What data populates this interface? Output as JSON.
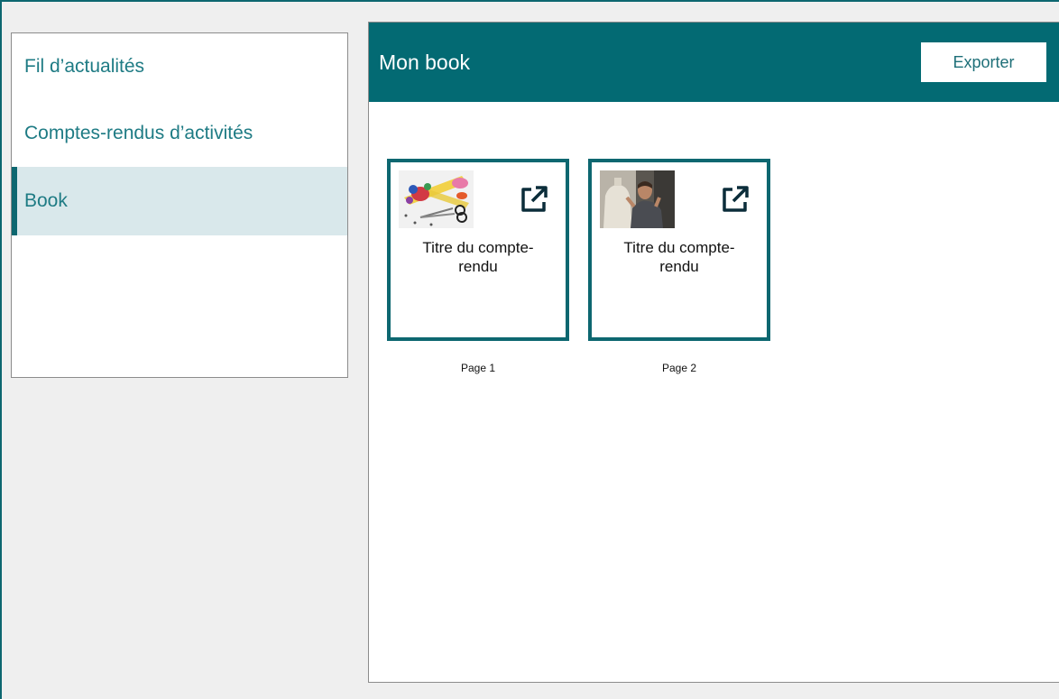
{
  "sidebar": {
    "items": [
      {
        "label": "Fil d’actualités",
        "active": false
      },
      {
        "label": "Comptes-rendus d’activités",
        "active": false
      },
      {
        "label": "Book",
        "active": true
      }
    ]
  },
  "main": {
    "title": "Mon book",
    "export_label": "Exporter",
    "cards": [
      {
        "title_line1": "Titre du compte-",
        "title_line2": "rendu",
        "page_label": "Page 1",
        "thumbnail": "sewing-supplies-photo",
        "icon": "external-link-icon"
      },
      {
        "title_line1": "Titre du compte-",
        "title_line2": "rendu",
        "page_label": "Page 2",
        "thumbnail": "tailor-with-mannequin-photo",
        "icon": "external-link-icon"
      }
    ]
  },
  "colors": {
    "accent": "#036a73",
    "link_text": "#1e7b84",
    "active_bg": "#d9e8eb",
    "app_bg": "#efefef"
  }
}
